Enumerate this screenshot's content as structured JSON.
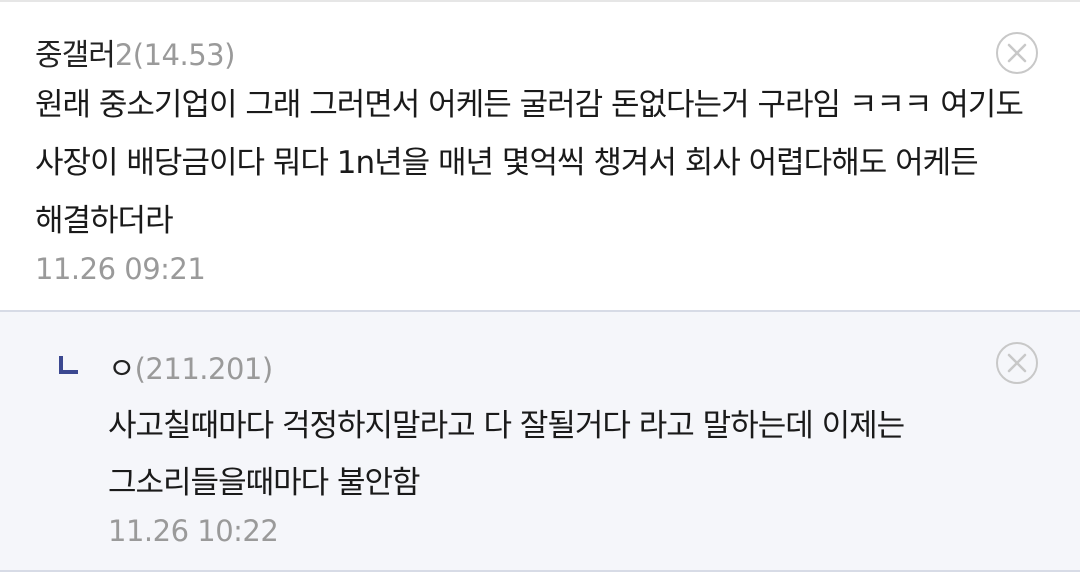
{
  "comments": [
    {
      "nickname": "중갤러",
      "ip": "2(14.53)",
      "content": "원래 중소기업이 그래 그러면서 어케든 굴러감 돈없다는거 구라임 ㅋㅋㅋ 여기도 사장이 배당금이다 뭐다 1n년을 매년 몇억씩 챙겨서 회사 어렵다해도 어케든 해결하더라",
      "timestamp": "11.26 09:21",
      "delete_icon": "close-circle-icon"
    }
  ],
  "replies": [
    {
      "reply_icon": "reply-arrow-icon",
      "nickname": "ㅇ",
      "ip": "(211.201)",
      "content": "사고칠때마다 걱정하지말라고 다 잘될거다 라고 말하는데 이제는 그소리들을때마다 불안함",
      "timestamp": "11.26 10:22",
      "delete_icon": "close-circle-icon"
    }
  ],
  "colors": {
    "text": "#1a1a1a",
    "meta": "#9a9a9a",
    "reply_bg": "#f5f6fa",
    "reply_icon": "#3b4890",
    "delete_icon": "#c8c8c8"
  }
}
